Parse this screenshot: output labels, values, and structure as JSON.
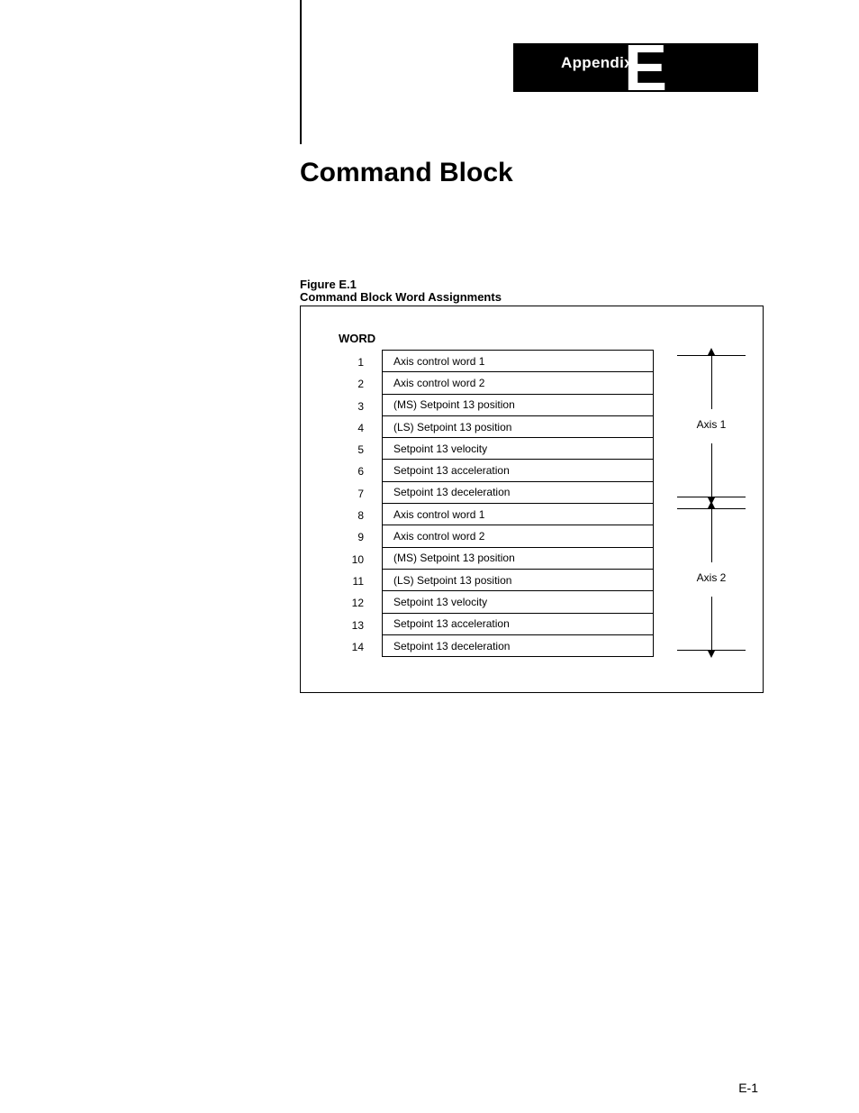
{
  "header": {
    "appendix_label": "Appendix",
    "appendix_letter": "E"
  },
  "title": "Command Block",
  "figure": {
    "caption_line1": "Figure E.1",
    "caption_line2": "Command Block Word Assignments",
    "word_header": "WORD",
    "axis1_label": "Axis 1",
    "axis2_label": "Axis 2",
    "rows": [
      {
        "n": "1",
        "desc": "Axis control word 1"
      },
      {
        "n": "2",
        "desc": "Axis control word 2"
      },
      {
        "n": "3",
        "desc": "(MS) Setpoint 13 position"
      },
      {
        "n": "4",
        "desc": "(LS) Setpoint 13 position"
      },
      {
        "n": "5",
        "desc": "Setpoint 13 velocity"
      },
      {
        "n": "6",
        "desc": "Setpoint 13 acceleration"
      },
      {
        "n": "7",
        "desc": "Setpoint 13 deceleration"
      },
      {
        "n": "8",
        "desc": "Axis control word 1"
      },
      {
        "n": "9",
        "desc": "Axis control word 2"
      },
      {
        "n": "10",
        "desc": "(MS) Setpoint 13 position"
      },
      {
        "n": "11",
        "desc": "(LS) Setpoint 13 position"
      },
      {
        "n": "12",
        "desc": "Setpoint 13 velocity"
      },
      {
        "n": "13",
        "desc": "Setpoint 13 acceleration"
      },
      {
        "n": "14",
        "desc": "Setpoint 13 deceleration"
      }
    ]
  },
  "page_number": "E-1"
}
